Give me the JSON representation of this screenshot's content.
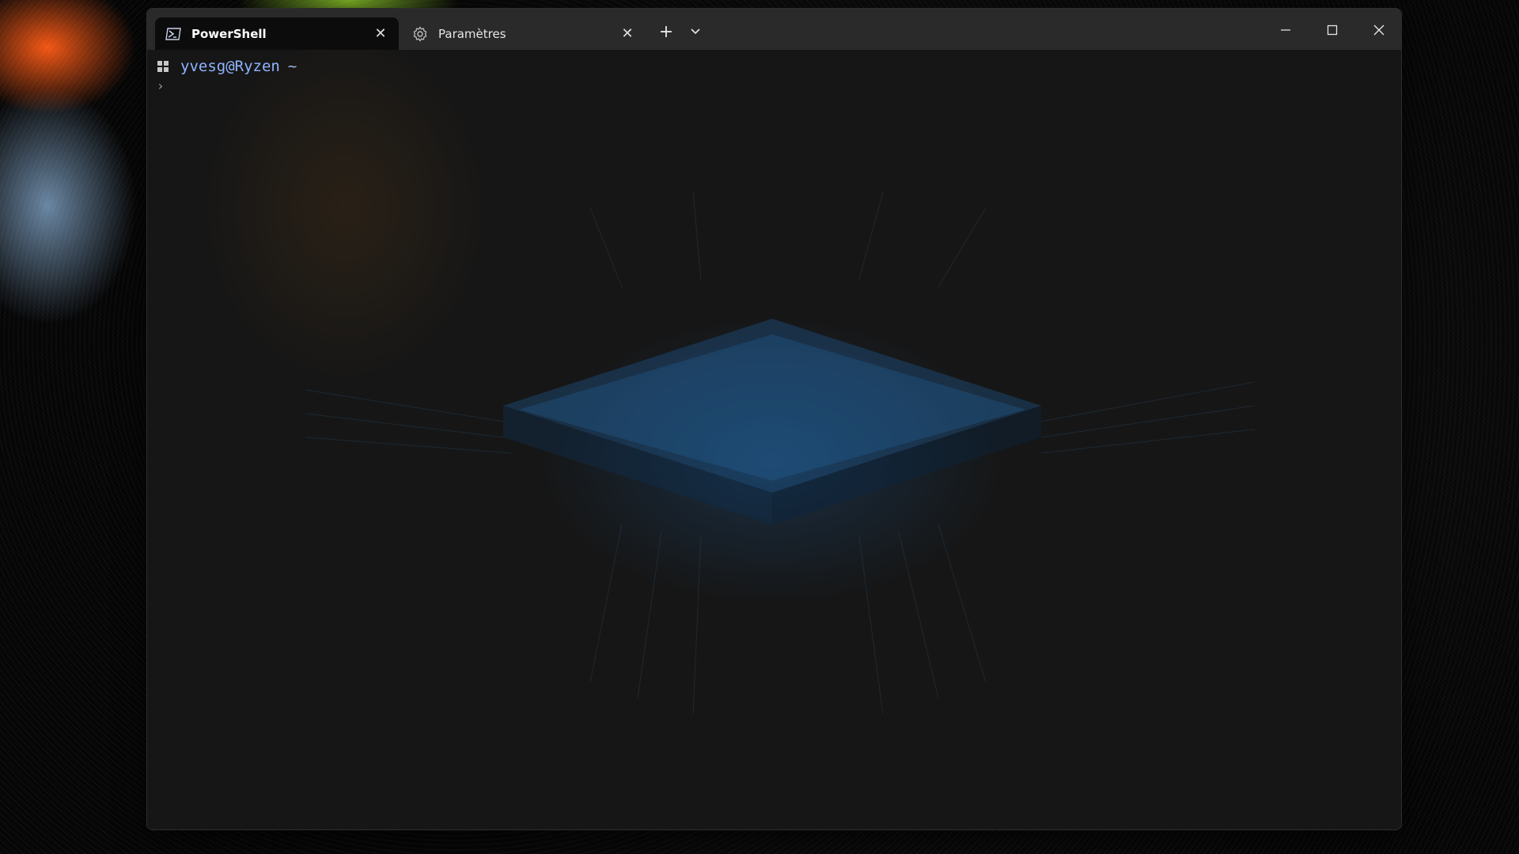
{
  "window": {
    "tabs": [
      {
        "label": "PowerShell",
        "icon": "powershell-icon",
        "active": true
      },
      {
        "label": "Paramètres",
        "icon": "gear-icon",
        "active": false
      }
    ],
    "new_tab_symbol": "+",
    "close_symbol": "✕"
  },
  "terminal": {
    "user_host": "yvesg@Ryzen",
    "path": "~",
    "prompt_symbol": "›"
  },
  "colors": {
    "tab_active_bg": "#0c0c0c",
    "titlebar_bg": "#2a2a2a",
    "prompt_user": "#8fb4ff",
    "accent_blue": "#1e5a96"
  }
}
